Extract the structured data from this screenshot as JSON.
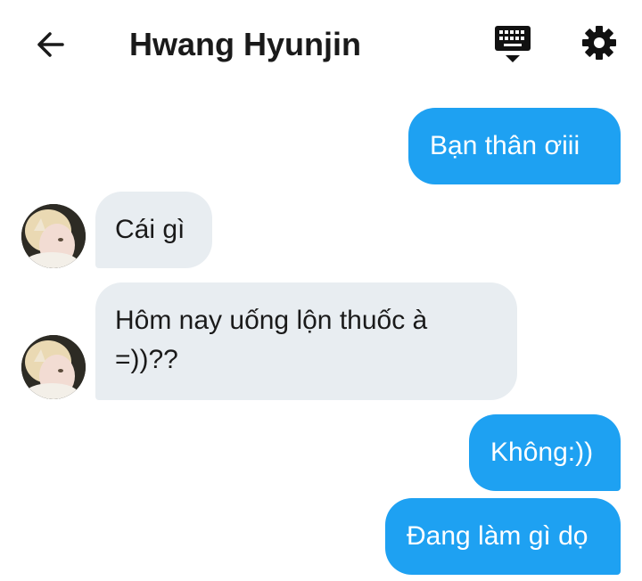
{
  "header": {
    "title": "Hwang Hyunjin",
    "back_icon": "arrow-left-icon",
    "keyboard_icon": "keyboard-icon",
    "settings_icon": "gear-icon"
  },
  "colors": {
    "outgoing_bubble": "#1ea1f2",
    "incoming_bubble": "#e8edf1"
  },
  "messages": [
    {
      "direction": "outgoing",
      "text": "Bạn thân ơiii"
    },
    {
      "direction": "incoming",
      "text": "Cái gì"
    },
    {
      "direction": "incoming",
      "text": "Hôm nay uống lộn thuốc à =))??"
    },
    {
      "direction": "outgoing",
      "text": "Không:))"
    },
    {
      "direction": "outgoing",
      "text": "Đang làm gì dọ"
    }
  ]
}
